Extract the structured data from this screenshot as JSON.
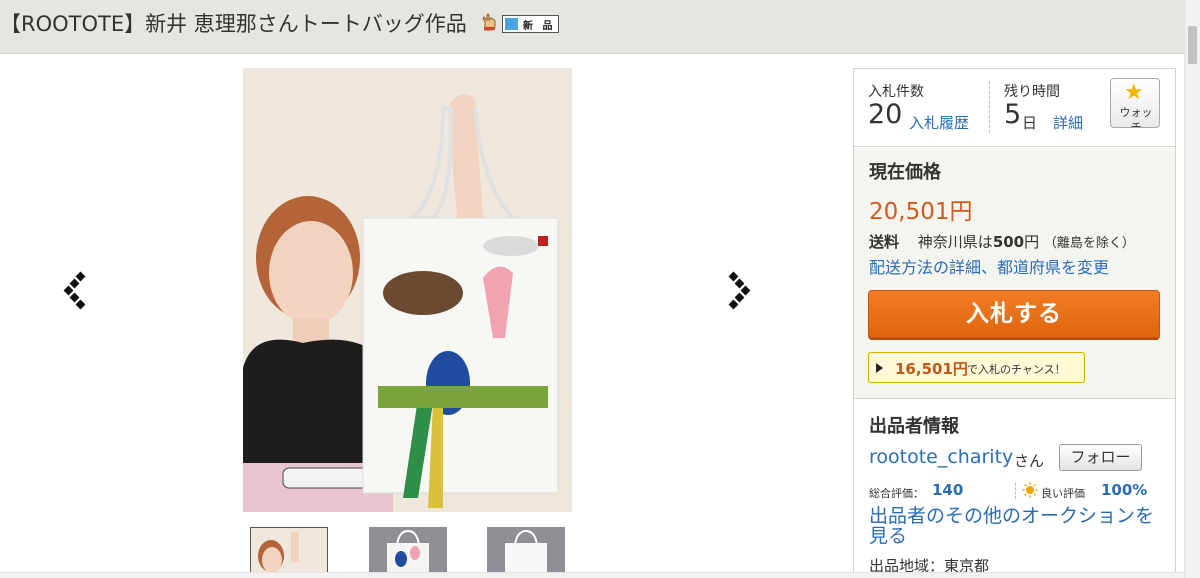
{
  "page": {
    "title": "【ROOTOTE】新井 恵理那さんトートバッグ作品",
    "new_badge": "新 品"
  },
  "icons": {
    "hand": "hand-pointing-icon",
    "prev": "prev-arrow-icon",
    "next": "next-arrow-icon",
    "watch_star": "star-icon",
    "sun": "sun-icon",
    "play": "play-triangle-icon"
  },
  "stats": {
    "bids_label": "入札件数",
    "bids_count": "20",
    "bids_history_link": "入札履歴",
    "time_label": "残り時間",
    "time_value": "5",
    "time_unit": "日",
    "time_detail_link": "詳細"
  },
  "watch": {
    "label": "ウォッチ"
  },
  "price": {
    "heading": "現在価格",
    "value": "20,501円",
    "shipping_label": "送料",
    "shipping_pref": "神奈川県は",
    "shipping_amount": "500",
    "shipping_yen": "円",
    "shipping_note": "（離島を除く）",
    "shipping_link": "配送方法の詳細、都道府県を変更"
  },
  "bid": {
    "button_label": "入札する",
    "chance_amount": "16,501円",
    "chance_text": "で入札のチャンス！"
  },
  "seller": {
    "heading": "出品者情報",
    "name": "rootote_charity",
    "suffix": "さん",
    "follow_label": "フォロー",
    "total_rating_label": "総合評価：",
    "total_rating_value": "140",
    "good_rating_label": "良い評価",
    "good_rating_value": "100%",
    "other_auctions_link": "出品者のその他のオークションを見る",
    "region": "出品地域：東京都"
  },
  "colors": {
    "accent_orange": "#e0650f",
    "link_blue": "#2a6db5",
    "price_orange": "#d4591a",
    "title_bar_bg": "#e6e6e0"
  }
}
